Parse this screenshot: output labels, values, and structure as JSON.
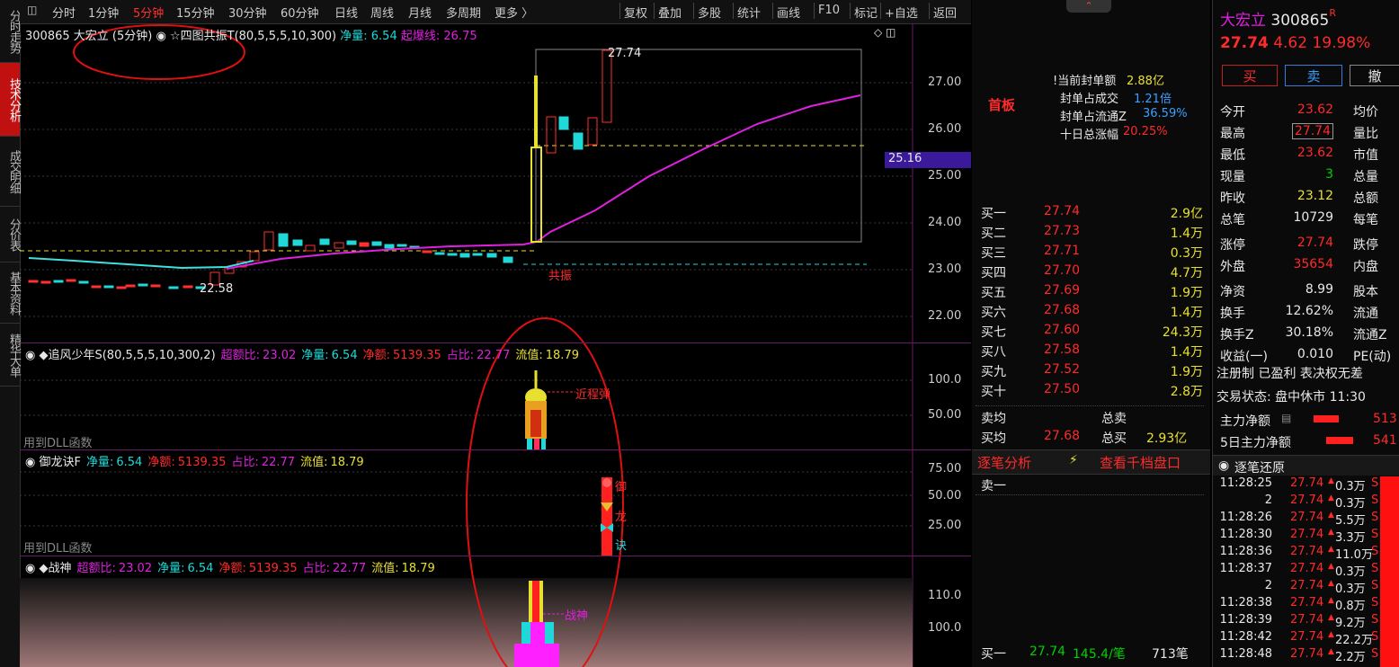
{
  "toolbar": {
    "items": [
      "分时",
      "1分钟",
      "5分钟",
      "15分钟",
      "30分钟",
      "60分钟",
      "日线",
      "周线",
      "月线",
      "多周期",
      "更多 〉"
    ],
    "active_index": 2,
    "right_items": [
      "复权",
      "叠加",
      "多股",
      "统计",
      "画线",
      "F10",
      "标记",
      "+自选",
      "返回"
    ]
  },
  "left_tabs": [
    "分时走势",
    "技术分析",
    "成交明细",
    "分价表",
    "基本资料",
    "精华大单"
  ],
  "left_active": 1,
  "main_pane": {
    "code": "300865",
    "name_period": "大宏立 (5分钟)",
    "indicator": "☆四图共振T(80,5,5,5,10,300)",
    "jl_label": "净量:",
    "jl_value": "6.54",
    "qbx_label": "起爆线:",
    "qbx_value": "26.75",
    "high_label": "27.74",
    "low_label": "22.58",
    "resonance_label": "共振",
    "current_price_tag": "25.16",
    "y_ticks": [
      "27.00",
      "26.00",
      "25.00",
      "24.00",
      "23.00",
      "22.00"
    ]
  },
  "pane2": {
    "title": "◆追风少年S(80,5,5,5,10,300,2)",
    "items": [
      {
        "label": "超额比:",
        "value": "23.02",
        "color": "#e020e0"
      },
      {
        "label": "净量:",
        "value": "6.54",
        "color": "#20d8d8"
      },
      {
        "label": "净额:",
        "value": "5139.35",
        "color": "#ff2a2a"
      },
      {
        "label": "占比:",
        "value": "22.77",
        "color": "#e020e0"
      },
      {
        "label": "流值:",
        "value": "18.79",
        "color": "#e8e030"
      }
    ],
    "annotation": "近程弹",
    "dll": "用到DLL函数",
    "y_ticks": [
      "100.0",
      "50.00"
    ]
  },
  "pane3": {
    "title": "御龙诀F",
    "items": [
      {
        "label": "净量:",
        "value": "6.54",
        "color": "#20d8d8"
      },
      {
        "label": "净额:",
        "value": "5139.35",
        "color": "#ff2a2a"
      },
      {
        "label": "占比:",
        "value": "22.77",
        "color": "#e020e0"
      },
      {
        "label": "流值:",
        "value": "18.79",
        "color": "#e8e030"
      }
    ],
    "marks": [
      "御",
      "龙",
      "诀"
    ],
    "dll": "用到DLL函数",
    "y_ticks": [
      "75.00",
      "50.00",
      "25.00"
    ]
  },
  "pane4": {
    "title": "◆战神",
    "items": [
      {
        "label": "超额比:",
        "value": "23.02",
        "color": "#e020e0"
      },
      {
        "label": "净量:",
        "value": "6.54",
        "color": "#20d8d8"
      },
      {
        "label": "净额:",
        "value": "5139.35",
        "color": "#ff2a2a"
      },
      {
        "label": "占比:",
        "value": "22.77",
        "color": "#e020e0"
      },
      {
        "label": "流值:",
        "value": "18.79",
        "color": "#e8e030"
      }
    ],
    "annotation": "战神",
    "y_ticks": [
      "110.0",
      "100.0"
    ]
  },
  "book": {
    "board": "首板",
    "stats": [
      {
        "label": "!当前封单额",
        "value": "2.88亿",
        "color": "#e8e030"
      },
      {
        "label": "封单占成交",
        "value": "1.21倍",
        "color": "#3aa0ff"
      },
      {
        "label": "封单占流通Z",
        "value": "36.59%",
        "color": "#3aa0ff"
      },
      {
        "label": "十日总涨幅",
        "value": "20.25%",
        "color": "#ff2a2a"
      }
    ],
    "bids": [
      {
        "name": "买一",
        "price": "27.74",
        "vol": "2.9亿"
      },
      {
        "name": "买二",
        "price": "27.73",
        "vol": "1.4万"
      },
      {
        "name": "买三",
        "price": "27.71",
        "vol": "0.3万"
      },
      {
        "name": "买四",
        "price": "27.70",
        "vol": "4.7万"
      },
      {
        "name": "买五",
        "price": "27.69",
        "vol": "1.9万"
      },
      {
        "name": "买六",
        "price": "27.68",
        "vol": "1.4万"
      },
      {
        "name": "买七",
        "price": "27.60",
        "vol": "24.3万"
      },
      {
        "name": "买八",
        "price": "27.58",
        "vol": "1.4万"
      },
      {
        "name": "买九",
        "price": "27.52",
        "vol": "1.9万"
      },
      {
        "name": "买十",
        "price": "27.50",
        "vol": "2.8万"
      }
    ],
    "sell_avg_label": "卖均",
    "total_sell_label": "总卖",
    "buy_avg_label": "买均",
    "buy_avg": "27.68",
    "total_buy_label": "总买",
    "total_buy": "2.93亿",
    "tab1": "逐笔分析",
    "tab2": "查看千档盘口",
    "sell1": "卖一",
    "footer": {
      "name": "买一",
      "price": "27.74",
      "per": "145.4/笔",
      "count": "713笔"
    }
  },
  "quote": {
    "name": "大宏立",
    "code": "300865",
    "badge": "R",
    "price": "27.74",
    "change": "4.62",
    "pct": "19.98%",
    "buy_btn": "买",
    "sell_btn": "卖",
    "cancel_btn": "撤",
    "rows": [
      {
        "l": "今开",
        "v": "23.62",
        "vc": "#ff2a2a",
        "r": "均价"
      },
      {
        "l": "最高",
        "v": "27.74",
        "vc": "#ff2a2a",
        "r": "量比"
      },
      {
        "l": "最低",
        "v": "23.62",
        "vc": "#ff2a2a",
        "r": "市值"
      },
      {
        "l": "现量",
        "v": "3",
        "vc": "#00d000",
        "r": "总量"
      },
      {
        "l": "昨收",
        "v": "23.12",
        "vc": "#e8e030",
        "r": "总额"
      },
      {
        "l": "总笔",
        "v": "10729",
        "vc": "#e8e8e8",
        "r": "每笔"
      },
      {
        "l": "涨停",
        "v": "27.74",
        "vc": "#ff2a2a",
        "r": "跌停"
      },
      {
        "l": "外盘",
        "v": "35654",
        "vc": "#ff2a2a",
        "r": "内盘"
      },
      {
        "l": "净资",
        "v": "8.99",
        "vc": "#e8e8e8",
        "r": "股本"
      },
      {
        "l": "换手",
        "v": "12.62%",
        "vc": "#e8e8e8",
        "r": "流通"
      },
      {
        "l": "换手Z",
        "v": "30.18%",
        "vc": "#e8e8e8",
        "r": "流通Z"
      },
      {
        "l": "收益(一)",
        "v": "0.010",
        "vc": "#e8e8e8",
        "r": "PE(动)"
      }
    ],
    "reg": "注册制 已盈利 表决权无差",
    "status": "交易状态: 盘中休市 11:30",
    "main_net": "主力净额",
    "main_net_val": "513",
    "main_net5": "5日主力净额",
    "main_net5_val": "541",
    "ticks_title": "逐笔还原",
    "ticks": [
      {
        "t": "11:28:25",
        "p": "27.74",
        "v": "0.3万"
      },
      {
        "t": "2",
        "p": "27.74",
        "v": "0.3万"
      },
      {
        "t": "11:28:26",
        "p": "27.74",
        "v": "5.5万"
      },
      {
        "t": "11:28:30",
        "p": "27.74",
        "v": "3.3万"
      },
      {
        "t": "11:28:36",
        "p": "27.74",
        "v": "11.0万"
      },
      {
        "t": "11:28:37",
        "p": "27.74",
        "v": "0.3万"
      },
      {
        "t": "2",
        "p": "27.74",
        "v": "0.3万"
      },
      {
        "t": "11:28:38",
        "p": "27.74",
        "v": "0.8万"
      },
      {
        "t": "11:28:39",
        "p": "27.74",
        "v": "9.2万"
      },
      {
        "t": "11:28:42",
        "p": "27.74",
        "v": "22.2万"
      },
      {
        "t": "11:28:48",
        "p": "27.74",
        "v": "2.2万"
      }
    ]
  }
}
